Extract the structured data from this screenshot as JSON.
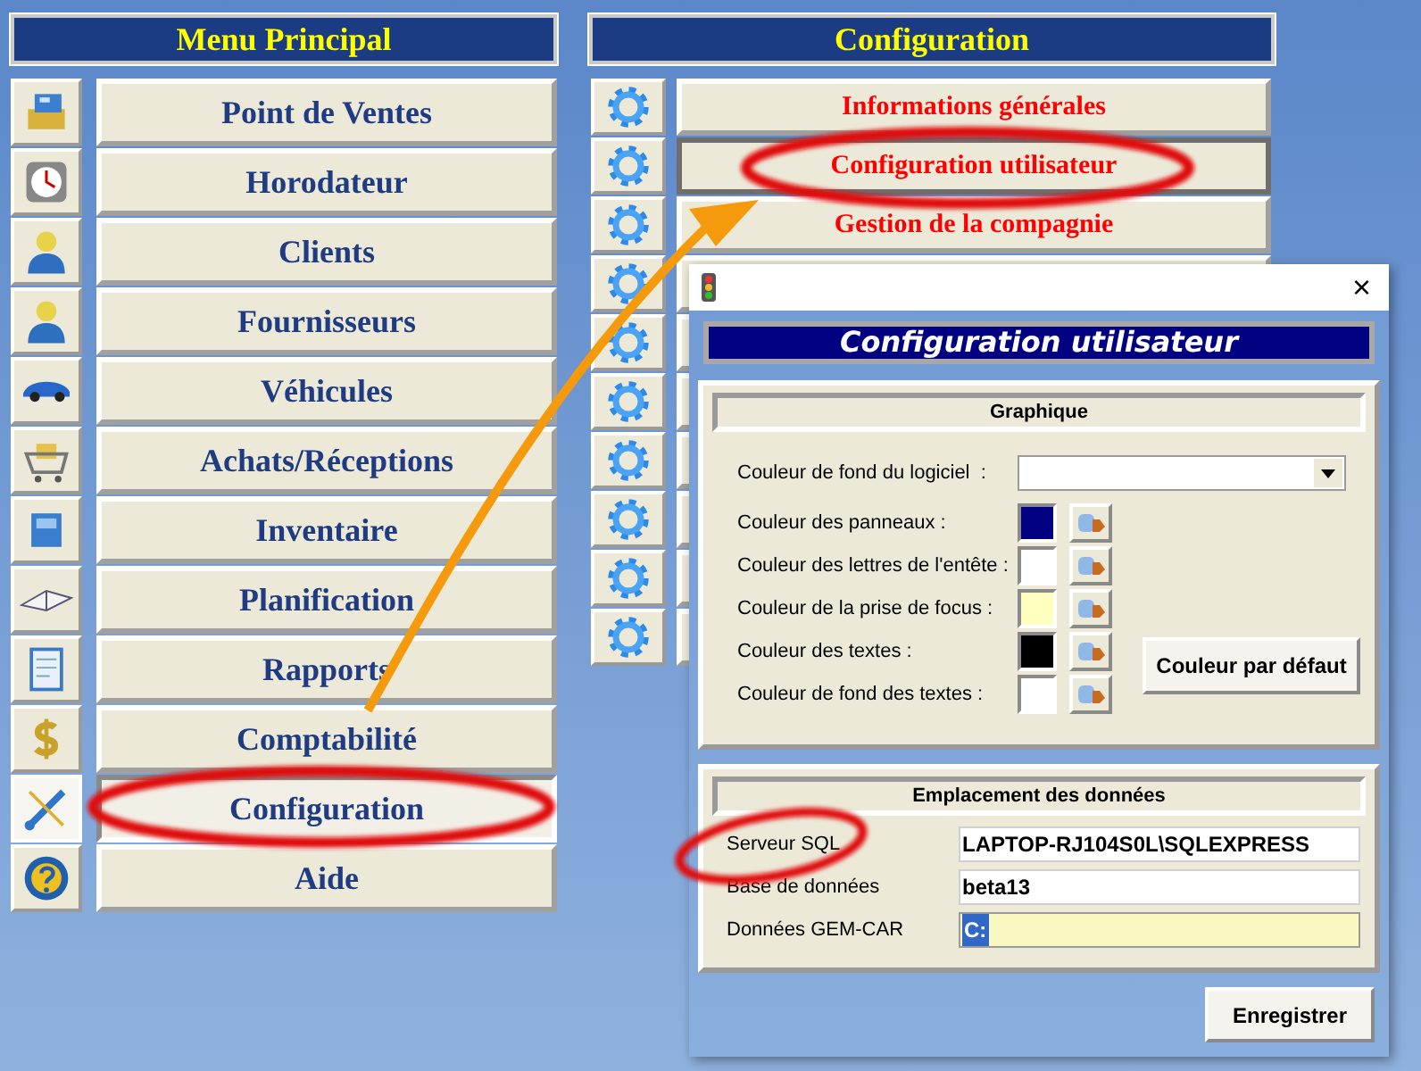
{
  "main_menu": {
    "title": "Menu Principal",
    "items": [
      {
        "label": "Point de Ventes",
        "selected": false
      },
      {
        "label": "Horodateur",
        "selected": false
      },
      {
        "label": "Clients",
        "selected": false
      },
      {
        "label": "Fournisseurs",
        "selected": false
      },
      {
        "label": "Véhicules",
        "selected": false
      },
      {
        "label": "Achats/Réceptions",
        "selected": false
      },
      {
        "label": "Inventaire",
        "selected": false
      },
      {
        "label": "Planification",
        "selected": false
      },
      {
        "label": "Rapports",
        "selected": false
      },
      {
        "label": "Comptabilité",
        "selected": false
      },
      {
        "label": "Configuration",
        "selected": true
      },
      {
        "label": "Aide",
        "selected": false
      }
    ]
  },
  "configuration_menu": {
    "title": "Configuration",
    "items": [
      {
        "label": "Informations générales",
        "selected": false
      },
      {
        "label": "Configuration utilisateur",
        "selected": true
      },
      {
        "label": "Gestion de la compagnie",
        "selected": false
      },
      {
        "selected": false
      },
      {
        "selected": false
      },
      {
        "selected": false
      },
      {
        "selected": false
      },
      {
        "selected": false
      },
      {
        "selected": false
      },
      {
        "selected": false
      }
    ]
  },
  "dialog": {
    "close": "×",
    "header": "Configuration utilisateur",
    "graphics": {
      "title": "Graphique",
      "rows": [
        {
          "kind": "dropdown",
          "label": "Couleur de fond du logiciel  :"
        },
        {
          "kind": "swatch",
          "label": "Couleur des panneaux :",
          "color": "#000080"
        },
        {
          "kind": "swatch",
          "label": "Couleur des lettres de l'entête :",
          "color": "#ffffff"
        },
        {
          "kind": "swatch",
          "label": "Couleur de la prise de focus :",
          "color": "#ffffc0"
        },
        {
          "kind": "swatch",
          "label": "Couleur des textes :",
          "color": "#000000"
        },
        {
          "kind": "swatch",
          "label": "Couleur de fond des textes :",
          "color": "#ffffff"
        }
      ],
      "default_button": "Couleur par défaut"
    },
    "data_location": {
      "title": "Emplacement des données",
      "fields": [
        {
          "label": "Serveur SQL",
          "value": "LAPTOP-RJ104S0L\\SQLEXPRESS",
          "focused": false
        },
        {
          "label": "Base de données",
          "value": "beta13",
          "focused": false
        },
        {
          "label": "Données GEM-CAR",
          "value": "C:",
          "focused": true
        }
      ]
    },
    "save_button": "Enregistrer"
  }
}
